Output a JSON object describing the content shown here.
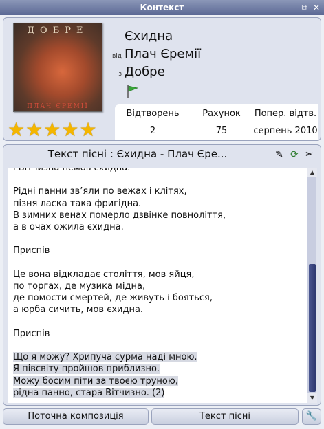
{
  "window": {
    "title": "Контекст",
    "icons": [
      "restore-icon",
      "close-icon"
    ]
  },
  "track": {
    "title": "Єхидна",
    "from_label": "від",
    "artist": "Плач Єремії",
    "album_prefix": "з",
    "album": "Добре"
  },
  "cover": {
    "top_text": "ДОБРЕ",
    "bottom_text": "ПЛАЧ ЄРЕМІЇ"
  },
  "stats": {
    "headers": [
      "Відтворень",
      "Рахунок",
      "Попер. відтв."
    ],
    "values": [
      "2",
      "75",
      "серпень 2010"
    ]
  },
  "rating": {
    "stars": 5,
    "max": 5
  },
  "lyrics": {
    "title": "Текст пісні : Єхидна - Плач Єре...",
    "lines": [
      "і Вітчизна немов єхидна.",
      "",
      "Рідні панни зв’яли по вежах і клітях,",
      "пізня ласка така фригідна.",
      "В зимних венах померло дзвінке повноліття,",
      "а в очах ожила єхидна.",
      "",
      "Приспів",
      "",
      "Це вона відкладає століття, мов яйця,",
      "по торгах, де музика мідна,",
      "де помости смертей, де живуть і бояться,",
      "а юрба сичить, мов єхидна.",
      "",
      "Приспів",
      "",
      "Що я можу? Хрипуча сурма наді мною.",
      "Я півсвіту пройшов приблизно.",
      "Можу босим піти за твоєю труною,",
      "рідна панно, стара Вітчизно. (2)"
    ],
    "highlight_from": 16
  },
  "bottom": {
    "tab_current": "Поточна композиція",
    "tab_lyrics": "Текст пісні"
  }
}
